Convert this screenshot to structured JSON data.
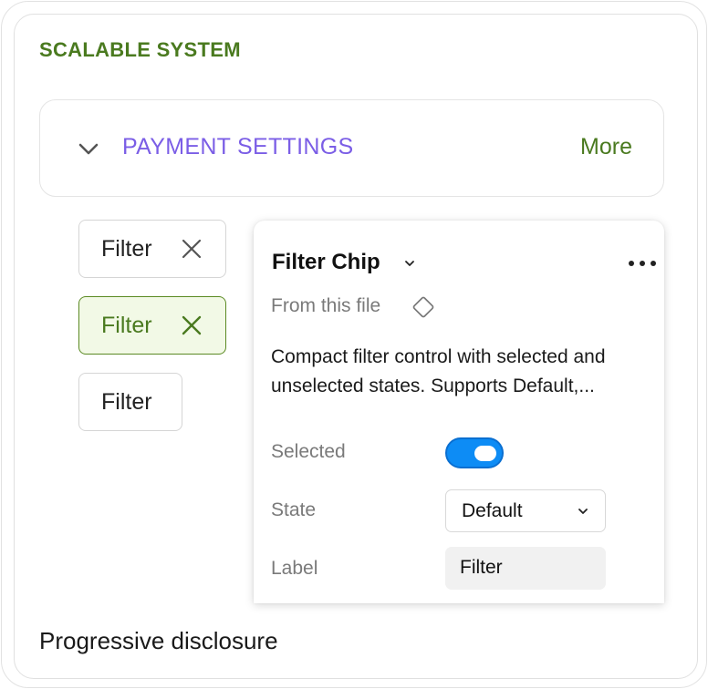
{
  "section": {
    "title": "SCALABLE SYSTEM"
  },
  "accordion": {
    "title": "PAYMENT SETTINGS",
    "action": "More",
    "icon": "chevron-down-icon"
  },
  "chips": [
    {
      "label": "Filter",
      "selected": false,
      "removable": true
    },
    {
      "label": "Filter",
      "selected": true,
      "removable": true
    },
    {
      "label": "Filter",
      "selected": false,
      "removable": false
    }
  ],
  "panel": {
    "title": "Filter Chip",
    "source": "From this file",
    "description_line1": "Compact filter control with selected and",
    "description_line2": "unselected states. Supports Default,...",
    "props": {
      "selected_label": "Selected",
      "selected_value": true,
      "state_label": "State",
      "state_value": "Default",
      "label_label": "Label",
      "label_value": "Filter"
    }
  },
  "footer": {
    "title": "Progressive disclosure"
  },
  "colors": {
    "green_accent": "#4a7a1f",
    "purple_accent": "#7b5ee6",
    "toggle_blue": "#0d8cf5",
    "selected_chip_bg": "#f2f9e6"
  }
}
